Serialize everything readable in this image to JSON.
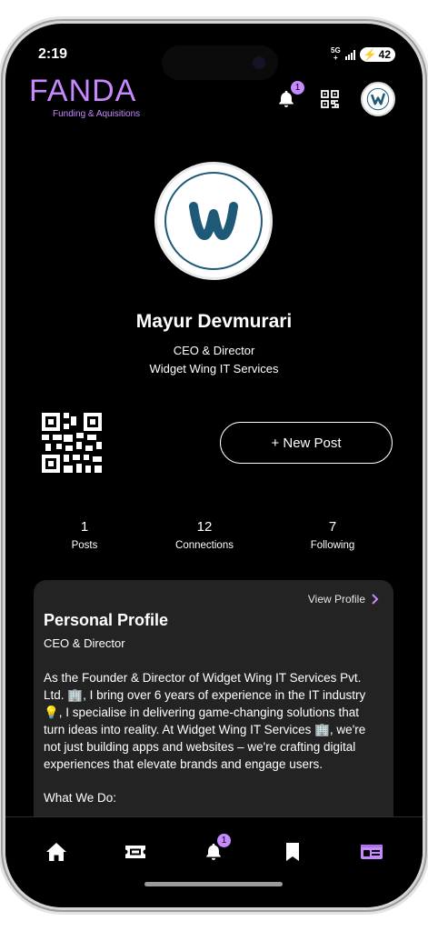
{
  "status_bar": {
    "time": "2:19",
    "network_top": "5G",
    "network_bottom": "+",
    "battery": "42"
  },
  "header": {
    "brand": "FANDA",
    "tagline": "Funding & Aquisitions",
    "notification_count": "1"
  },
  "profile": {
    "name": "Mayur Devmurari",
    "role": "CEO & Director",
    "company": "Widget Wing IT Services",
    "avatar_logo_letter": "w"
  },
  "actions": {
    "new_post_label": "+ New Post"
  },
  "stats": [
    {
      "value": "1",
      "label": "Posts"
    },
    {
      "value": "12",
      "label": "Connections"
    },
    {
      "value": "7",
      "label": "Following"
    }
  ],
  "card": {
    "view_profile_label": "View Profile",
    "title": "Personal Profile",
    "subtitle": "CEO & Director",
    "paragraph": "As the Founder & Director of Widget Wing IT Services Pvt. Ltd. 🏢, I bring over 6 years of experience in the IT industry 💡, I specialise in delivering game-changing solutions that turn ideas into reality. At Widget Wing IT Services 🏢, we're not just building apps and websites – we're crafting digital experiences that elevate brands and engage users.",
    "section_heading": "What We Do:"
  },
  "bottom_nav": {
    "notification_count": "1",
    "active_item": "profile"
  },
  "colors": {
    "accent": "#c789ff",
    "background": "#000000",
    "card": "#232323"
  }
}
